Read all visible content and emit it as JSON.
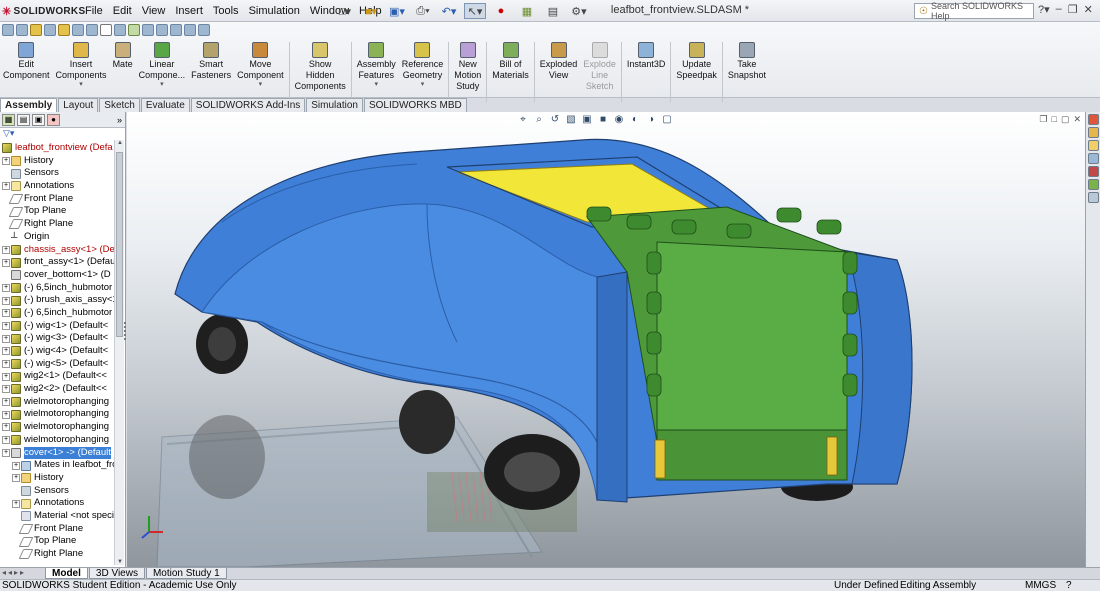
{
  "app": {
    "logo_text": "SOLIDWORKS",
    "document_title": "leafbot_frontview.SLDASM *"
  },
  "menu": [
    "File",
    "Edit",
    "View",
    "Insert",
    "Tools",
    "Simulation",
    "Window",
    "Help"
  ],
  "help_search": {
    "placeholder": "Search SOLIDWORKS Help"
  },
  "command_manager": {
    "buttons": [
      {
        "label_lines": [
          "Edit",
          "Component"
        ],
        "icon": "edit-component-icon",
        "dropdown": false,
        "disabled": false
      },
      {
        "label_lines": [
          "Insert",
          "Components"
        ],
        "icon": "insert-components-icon",
        "dropdown": true,
        "disabled": false
      },
      {
        "label_lines": [
          "Mate"
        ],
        "icon": "mate-icon",
        "dropdown": false,
        "disabled": false
      },
      {
        "label_lines": [
          "Linear",
          "Compone..."
        ],
        "icon": "linear-pattern-icon",
        "dropdown": true,
        "disabled": false
      },
      {
        "label_lines": [
          "Smart",
          "Fasteners"
        ],
        "icon": "smart-fasteners-icon",
        "dropdown": false,
        "disabled": false
      },
      {
        "label_lines": [
          "Move",
          "Component"
        ],
        "icon": "move-component-icon",
        "dropdown": true,
        "disabled": false
      },
      {
        "label_lines": [
          "Show",
          "Hidden",
          "Components"
        ],
        "icon": "show-hidden-icon",
        "dropdown": false,
        "disabled": false
      },
      {
        "label_lines": [
          "Assembly",
          "Features"
        ],
        "icon": "assembly-features-icon",
        "dropdown": true,
        "disabled": false
      },
      {
        "label_lines": [
          "Reference",
          "Geometry"
        ],
        "icon": "reference-geometry-icon",
        "dropdown": true,
        "disabled": false
      },
      {
        "label_lines": [
          "New",
          "Motion",
          "Study"
        ],
        "icon": "motion-study-icon",
        "dropdown": false,
        "disabled": false
      },
      {
        "label_lines": [
          "Bill of",
          "Materials"
        ],
        "icon": "bill-of-materials-icon",
        "dropdown": false,
        "disabled": false
      },
      {
        "label_lines": [
          "Exploded",
          "View"
        ],
        "icon": "exploded-view-icon",
        "dropdown": false,
        "disabled": false
      },
      {
        "label_lines": [
          "Explode",
          "Line",
          "Sketch"
        ],
        "icon": "explode-line-icon",
        "dropdown": false,
        "disabled": true
      },
      {
        "label_lines": [
          "Instant3D"
        ],
        "icon": "instant3d-icon",
        "dropdown": false,
        "disabled": false
      },
      {
        "label_lines": [
          "Update",
          "Speedpak"
        ],
        "icon": "speedpak-icon",
        "dropdown": false,
        "disabled": false
      },
      {
        "label_lines": [
          "Take",
          "Snapshot"
        ],
        "icon": "snapshot-icon",
        "dropdown": false,
        "disabled": false
      }
    ],
    "tabs": [
      "Assembly",
      "Layout",
      "Sketch",
      "Evaluate",
      "SOLIDWORKS Add-Ins",
      "Simulation",
      "SOLIDWORKS MBD"
    ],
    "active_tab": "Assembly"
  },
  "feature_tree": {
    "root": "leafbot_frontview  (Defa",
    "items": [
      {
        "label": "History",
        "icon": "folder",
        "indent": 1,
        "expander": true
      },
      {
        "label": "Sensors",
        "icon": "sensor",
        "indent": 1,
        "expander": false
      },
      {
        "label": "Annotations",
        "icon": "annot",
        "indent": 1,
        "expander": true
      },
      {
        "label": "Front Plane",
        "icon": "plane",
        "indent": 1,
        "expander": false
      },
      {
        "label": "Top Plane",
        "icon": "plane",
        "indent": 1,
        "expander": false
      },
      {
        "label": "Right Plane",
        "icon": "plane",
        "indent": 1,
        "expander": false
      },
      {
        "label": "Origin",
        "icon": "origin",
        "indent": 1,
        "expander": false
      },
      {
        "label": "chassis_assy<1> (Def",
        "icon": "comp",
        "indent": 1,
        "expander": true,
        "error": true
      },
      {
        "label": "front_assy<1> (Defau",
        "icon": "comp",
        "indent": 1,
        "expander": true
      },
      {
        "label": "cover_bottom<1> (D",
        "icon": "part",
        "indent": 1,
        "expander": false
      },
      {
        "label": "(-) 6,5inch_hubmotor",
        "icon": "comp",
        "indent": 1,
        "expander": true
      },
      {
        "label": "(-) brush_axis_assy<1",
        "icon": "comp",
        "indent": 1,
        "expander": true
      },
      {
        "label": "(-) 6,5inch_hubmotor",
        "icon": "comp",
        "indent": 1,
        "expander": true
      },
      {
        "label": "(-) wig<1> (Default<",
        "icon": "comp",
        "indent": 1,
        "expander": true
      },
      {
        "label": "(-) wig<3> (Default<",
        "icon": "comp",
        "indent": 1,
        "expander": true
      },
      {
        "label": "(-) wig<4> (Default<",
        "icon": "comp",
        "indent": 1,
        "expander": true
      },
      {
        "label": "(-) wig<5> (Default<",
        "icon": "comp",
        "indent": 1,
        "expander": true
      },
      {
        "label": "wig2<1> (Default<<",
        "icon": "comp",
        "indent": 1,
        "expander": true
      },
      {
        "label": "wig2<2> (Default<<",
        "icon": "comp",
        "indent": 1,
        "expander": true
      },
      {
        "label": "wielmotorophanging",
        "icon": "comp",
        "indent": 1,
        "expander": true
      },
      {
        "label": "wielmotorophanging",
        "icon": "comp",
        "indent": 1,
        "expander": true
      },
      {
        "label": "wielmotorophanging",
        "icon": "comp",
        "indent": 1,
        "expander": true
      },
      {
        "label": "wielmotorophanging",
        "icon": "comp",
        "indent": 1,
        "expander": true
      },
      {
        "label": "cover<1> -> (Default",
        "icon": "part",
        "indent": 1,
        "expander": true,
        "selected": true
      },
      {
        "label": "Mates in leafbot_fror",
        "icon": "mates",
        "indent": 2,
        "expander": true
      },
      {
        "label": "History",
        "icon": "folder",
        "indent": 2,
        "expander": true
      },
      {
        "label": "Sensors",
        "icon": "sensor",
        "indent": 2,
        "expander": false
      },
      {
        "label": "Annotations",
        "icon": "annot",
        "indent": 2,
        "expander": true
      },
      {
        "label": "Material <not specifi",
        "icon": "mat",
        "indent": 2,
        "expander": false
      },
      {
        "label": "Front Plane",
        "icon": "plane",
        "indent": 2,
        "expander": false
      },
      {
        "label": "Top Plane",
        "icon": "plane",
        "indent": 2,
        "expander": false
      },
      {
        "label": "Right Plane",
        "icon": "plane",
        "indent": 2,
        "expander": false
      }
    ]
  },
  "bottom_tabs": [
    "Model",
    "3D Views",
    "Motion Study 1"
  ],
  "active_bottom_tab": "Model",
  "status": {
    "left": "SOLIDWORKS Student Edition - Academic Use Only",
    "state": "Under Defined",
    "mode": "Editing Assembly",
    "units": "MMGS",
    "help": "?"
  },
  "colors": {
    "body_blue": "#3f7fd8",
    "body_blue_dark": "#2b5ea8",
    "green_module": "#4e9a3a",
    "yellow_panel": "#f2e639",
    "selection": "#3b7fd6"
  }
}
